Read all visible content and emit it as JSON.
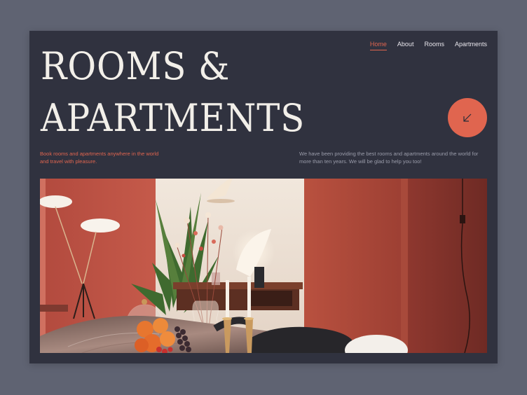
{
  "hero": {
    "title": "ROOMS &\nAPARTMENTS"
  },
  "nav": {
    "items": [
      {
        "label": "Home",
        "active": true
      },
      {
        "label": "About",
        "active": false
      },
      {
        "label": "Rooms",
        "active": false
      },
      {
        "label": "Apartments",
        "active": false
      }
    ]
  },
  "cta": {
    "icon": "arrow-down-left-icon"
  },
  "tagline": "Book rooms and apartments anywhere in the world and travel with pleasure.",
  "about": "We have been providing the best rooms  and apartments around the world for more than ten years. We will be glad to help you too!",
  "colors": {
    "background": "#5f6372",
    "panel": "#30323f",
    "accent": "#e0654f",
    "title": "#f2efe9"
  }
}
